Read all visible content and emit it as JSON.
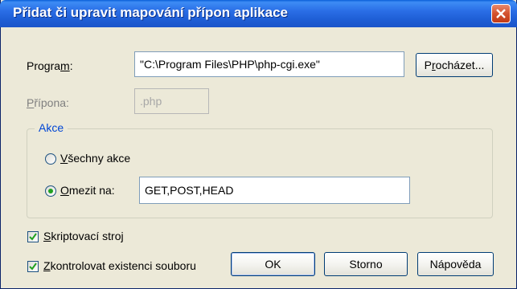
{
  "window": {
    "title": "Přidat či upravit mapování přípon aplikace"
  },
  "program": {
    "label_pre": "Progra",
    "label_key": "m",
    "label_post": ":",
    "value": "\"C:\\Program Files\\PHP\\php-cgi.exe\""
  },
  "browse_button": {
    "label_pre": "P",
    "label_key": "r",
    "label_post": "ocházet..."
  },
  "extension": {
    "label_pre": "",
    "label_key": "P",
    "label_post": "řípona:",
    "value": ".php"
  },
  "actions": {
    "group_title": "Akce",
    "all_actions": {
      "label_key": "V",
      "label_post": "šechny akce",
      "selected": false
    },
    "limit_to": {
      "label_key": "O",
      "label_post": "mezit na:",
      "selected": true,
      "value": "GET,POST,HEAD"
    }
  },
  "script_engine": {
    "label_key": "S",
    "label_post": "kriptovací stroj",
    "checked": true
  },
  "verify_file": {
    "label_key": "Z",
    "label_post": "kontrolovat existenci souboru",
    "checked": true
  },
  "buttons": {
    "ok": "OK",
    "cancel": "Storno",
    "help": "Nápověda"
  },
  "colors": {
    "title_bar": "#1f5fd6",
    "dialog_bg": "#ece9d8",
    "group_title": "#0046d5",
    "radio_dot": "#21a121",
    "check_mark": "#21a121"
  }
}
